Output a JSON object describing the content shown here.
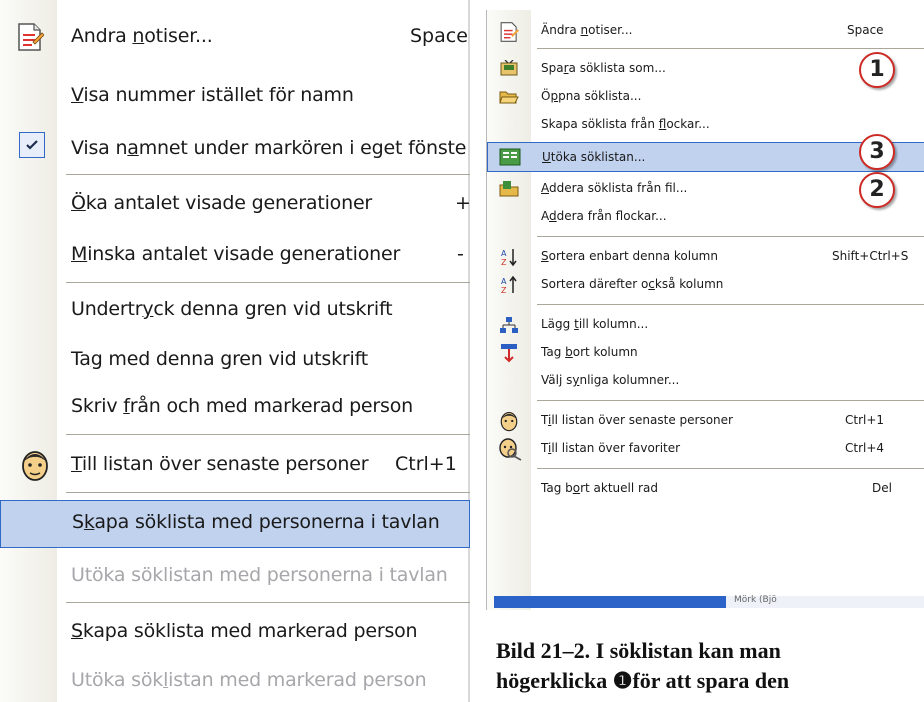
{
  "left_menu": {
    "items": [
      {
        "pre": "Andra ",
        "ul": "n",
        "post": "otiser...",
        "shortcut": "Space",
        "icon": "notes-icon"
      },
      {
        "pre": "",
        "ul": "V",
        "post": "isa nummer istället för namn",
        "shortcut": ""
      },
      {
        "pre": "Visa n",
        "ul": "a",
        "post": "mnet under markören i eget fönste",
        "shortcut": "",
        "checked": true
      },
      {
        "pre": "",
        "ul": "Ö",
        "post": "ka antalet visade generationer",
        "shortcut": "+"
      },
      {
        "pre": "",
        "ul": "M",
        "post": "inska antalet visade generationer",
        "shortcut": "-"
      },
      {
        "pre": "Undertr",
        "ul": "y",
        "post": "ck denna gren vid utskrift",
        "shortcut": ""
      },
      {
        "pre": "Ta",
        "ul": "g",
        "post": " med denna gren vid utskrift",
        "shortcut": ""
      },
      {
        "pre": "Skriv ",
        "ul": "f",
        "post": "rån och med markerad person",
        "shortcut": ""
      },
      {
        "pre": "",
        "ul": "T",
        "post": "ill listan över senaste personer",
        "shortcut": "Ctrl+1",
        "icon": "face-icon"
      },
      {
        "pre": "S",
        "ul": "k",
        "post": "apa söklista med personerna i tavlan",
        "shortcut": "",
        "highlight": true
      },
      {
        "pre": "Utöka söklistan med personerna i tavlan",
        "ul": "",
        "post": "",
        "shortcut": "",
        "disabled": true
      },
      {
        "pre": "",
        "ul": "S",
        "post": "kapa söklista med markerad person",
        "shortcut": ""
      },
      {
        "pre": "Utöka sök",
        "ul": "l",
        "post": "istan med markerad person",
        "shortcut": "",
        "disabled": true
      }
    ]
  },
  "right_menu": {
    "items": [
      {
        "pre": "Ändra ",
        "ul": "n",
        "post": "otiser...",
        "shortcut": "Space",
        "icon": "notes-icon"
      },
      {
        "pre": "Spa",
        "ul": "r",
        "post": "a söklista som...",
        "shortcut": "",
        "icon": "save-list-icon"
      },
      {
        "pre": "Ö",
        "ul": "p",
        "post": "pna söklista...",
        "shortcut": "",
        "icon": "open-folder-icon"
      },
      {
        "pre": "Skapa söklista från ",
        "ul": "f",
        "post": "lockar...",
        "shortcut": ""
      },
      {
        "pre": "",
        "ul": "U",
        "post": "töka söklistan...",
        "shortcut": "",
        "icon": "extend-list-icon",
        "highlight": true
      },
      {
        "pre": "",
        "ul": "A",
        "post": "ddera söklista från fil...",
        "shortcut": "",
        "icon": "add-file-icon"
      },
      {
        "pre": "A",
        "ul": "d",
        "post": "dera från flockar...",
        "shortcut": ""
      },
      {
        "pre": "",
        "ul": "S",
        "post": "ortera enbart denna kolumn",
        "shortcut": "Shift+Ctrl+S",
        "icon": "sort-az-icon"
      },
      {
        "pre": "Sortera därefter o",
        "ul": "c",
        "post": "kså kolumn",
        "shortcut": "",
        "icon": "sort-then-icon"
      },
      {
        "pre": "Lägg ",
        "ul": "t",
        "post": "ill kolumn...",
        "shortcut": "",
        "icon": "add-column-icon"
      },
      {
        "pre": "Tag ",
        "ul": "b",
        "post": "ort kolumn",
        "shortcut": "",
        "icon": "remove-column-icon"
      },
      {
        "pre": "Välj s",
        "ul": "y",
        "post": "nliga kolumner...",
        "shortcut": ""
      },
      {
        "pre": "T",
        "ul": "i",
        "post": "ll listan över senaste personer",
        "shortcut": "Ctrl+1",
        "icon": "face-icon"
      },
      {
        "pre": "T",
        "ul": "i",
        "post": "ll listan över favoriter",
        "shortcut": "Ctrl+4",
        "icon": "favorite-icon"
      },
      {
        "pre": "Tag b",
        "ul": "o",
        "post": "rt aktuell rad",
        "shortcut": "Del"
      }
    ],
    "badges": [
      "1",
      "3",
      "2"
    ],
    "status_fragment": "Mörk (Bjö"
  },
  "caption": {
    "line1": "Bild 21–2.   I söklistan kan man",
    "line2": "högerklicka ❶för att spara den"
  },
  "colors": {
    "highlight_bg": "#c1d2ee",
    "highlight_border": "#316ac5",
    "disabled_text": "#a7a6aa",
    "badge_border": "#cc2a24"
  }
}
